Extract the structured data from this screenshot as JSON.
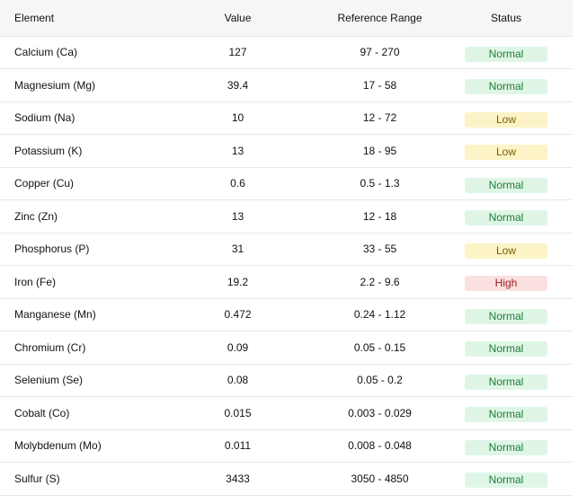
{
  "columns": {
    "element": "Element",
    "value": "Value",
    "range": "Reference Range",
    "status": "Status"
  },
  "rows": [
    {
      "element": "Calcium (Ca)",
      "value": "127",
      "range": "97 - 270",
      "status": "Normal"
    },
    {
      "element": "Magnesium (Mg)",
      "value": "39.4",
      "range": "17 - 58",
      "status": "Normal"
    },
    {
      "element": "Sodium (Na)",
      "value": "10",
      "range": "12 - 72",
      "status": "Low"
    },
    {
      "element": "Potassium (K)",
      "value": "13",
      "range": "18 - 95",
      "status": "Low"
    },
    {
      "element": "Copper (Cu)",
      "value": "0.6",
      "range": "0.5 - 1.3",
      "status": "Normal"
    },
    {
      "element": "Zinc (Zn)",
      "value": "13",
      "range": "12 - 18",
      "status": "Normal"
    },
    {
      "element": "Phosphorus (P)",
      "value": "31",
      "range": "33 - 55",
      "status": "Low"
    },
    {
      "element": "Iron (Fe)",
      "value": "19.2",
      "range": "2.2 - 9.6",
      "status": "High"
    },
    {
      "element": "Manganese (Mn)",
      "value": "0.472",
      "range": "0.24 - 1.12",
      "status": "Normal"
    },
    {
      "element": "Chromium (Cr)",
      "value": "0.09",
      "range": "0.05 - 0.15",
      "status": "Normal"
    },
    {
      "element": "Selenium (Se)",
      "value": "0.08",
      "range": "0.05 - 0.2",
      "status": "Normal"
    },
    {
      "element": "Cobalt (Co)",
      "value": "0.015",
      "range": "0.003 - 0.029",
      "status": "Normal"
    },
    {
      "element": "Molybdenum (Mo)",
      "value": "0.011",
      "range": "0.008 - 0.048",
      "status": "Normal"
    },
    {
      "element": "Sulfur (S)",
      "value": "3433",
      "range": "3050 - 4850",
      "status": "Normal"
    }
  ],
  "status_colors": {
    "Normal": {
      "background": "#dff6e6",
      "text": "#1e7b3a"
    },
    "Low": {
      "background": "#fcf4c6",
      "text": "#7a5d00"
    },
    "High": {
      "background": "#fbe0e1",
      "text": "#9b1c22"
    }
  }
}
